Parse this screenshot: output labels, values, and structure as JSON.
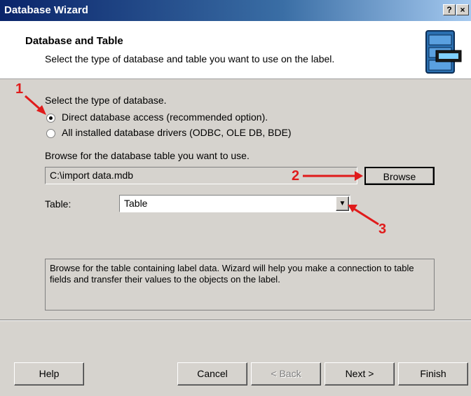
{
  "window": {
    "title": "Database Wizard",
    "help_btn": "?",
    "close_btn": "×"
  },
  "header": {
    "title": "Database and Table",
    "subtitle": "Select the type of database and table you want to use on the label."
  },
  "db_type": {
    "label": "Select the type of database.",
    "options": [
      {
        "label": "Direct database access (recommended option).",
        "selected": true
      },
      {
        "label": "All installed database drivers (ODBC, OLE DB, BDE)",
        "selected": false
      }
    ]
  },
  "browse": {
    "label": "Browse for the database table you want to use.",
    "path_value": "C:\\import data.mdb",
    "button_label": "Browse"
  },
  "table": {
    "label": "Table:",
    "selected": "Table"
  },
  "info_text": "Browse for the table containing label data. Wizard will help you make a connection to table fields and transfer their values to the objects on the label.",
  "footer": {
    "help": "Help",
    "cancel": "Cancel",
    "back": "< Back",
    "next": "Next >",
    "finish": "Finish"
  },
  "annotations": {
    "a1": "1",
    "a2": "2",
    "a3": "3",
    "color": "#e01b1b"
  }
}
